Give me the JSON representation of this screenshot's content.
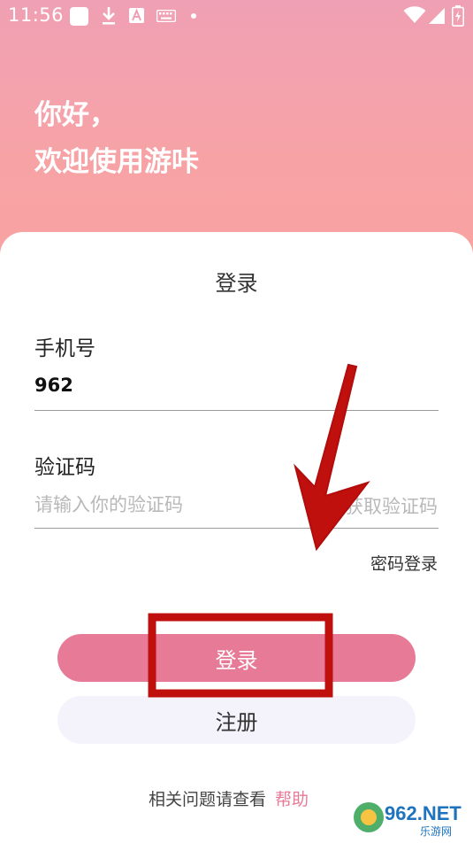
{
  "status_bar": {
    "time": "11:56",
    "icons": [
      "app-square-icon",
      "download-icon",
      "font-a-icon",
      "keyboard-icon",
      "dot-icon",
      "wifi-icon",
      "signal-icon",
      "battery-charging-icon"
    ]
  },
  "header": {
    "greeting_line1": "你好，",
    "greeting_line2": "欢迎使用游咔"
  },
  "form": {
    "title": "登录",
    "phone_label": "手机号",
    "phone_value": "962",
    "code_label": "验证码",
    "code_placeholder": "请输入你的验证码",
    "get_code": "获取验证码",
    "password_login": "密码登录"
  },
  "buttons": {
    "login": "登录",
    "register": "注册"
  },
  "footer": {
    "help_text": "相关问题请查看",
    "help_link": "帮助"
  },
  "watermark": {
    "brand": "962.NET",
    "sub": "乐游网"
  },
  "colors": {
    "accent": "#e67a97",
    "header_gradient_top": "#f0a0b4",
    "header_gradient_bottom": "#f9a2a1",
    "annotation_red": "#c0100e"
  }
}
